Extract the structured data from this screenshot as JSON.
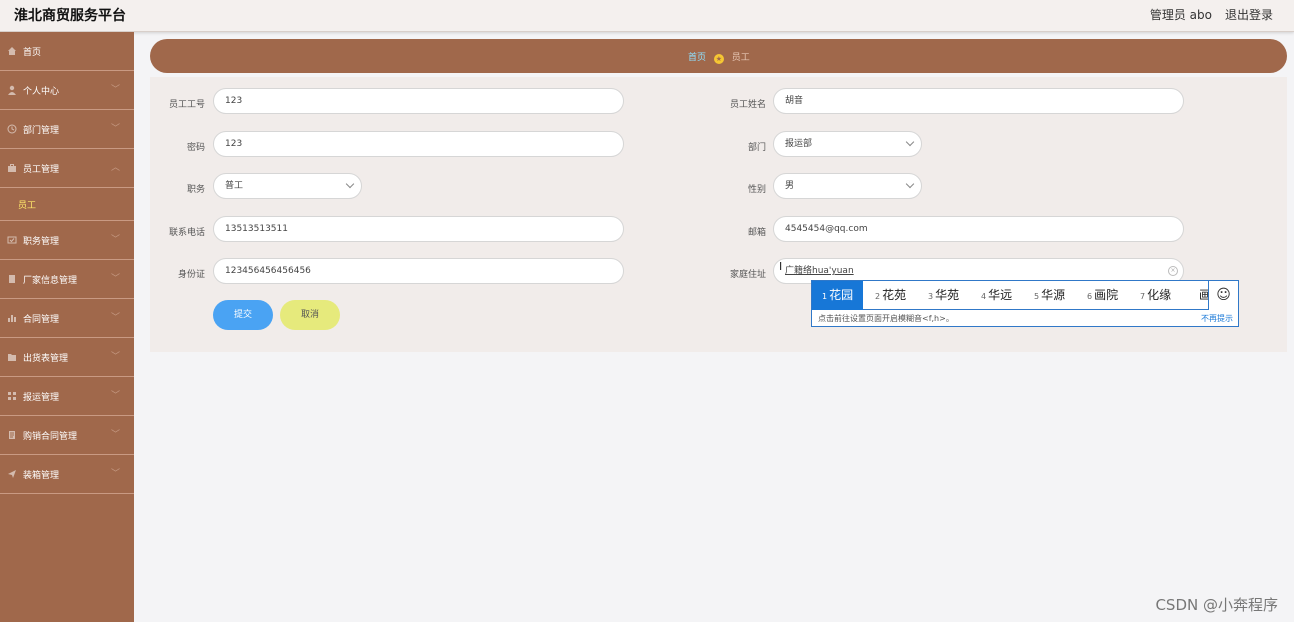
{
  "header": {
    "title": "淮北商贸服务平台",
    "user": "管理员 abo",
    "logout": "退出登录"
  },
  "sidebar": {
    "items": [
      {
        "label": "首页",
        "icon": "home-icon"
      },
      {
        "label": "个人中心",
        "icon": "user-icon"
      },
      {
        "label": "部门管理",
        "icon": "clock-icon"
      },
      {
        "label": "员工管理",
        "icon": "briefcase-icon"
      },
      {
        "label": "员工",
        "icon": ""
      },
      {
        "label": "职务管理",
        "icon": "id-card-icon"
      },
      {
        "label": "厂家信息管理",
        "icon": "file-icon"
      },
      {
        "label": "合同管理",
        "icon": "bar-chart-icon"
      },
      {
        "label": "出货表管理",
        "icon": "folder-icon"
      },
      {
        "label": "报运管理",
        "icon": "grid-icon"
      },
      {
        "label": "购销合同管理",
        "icon": "document-icon"
      },
      {
        "label": "装箱管理",
        "icon": "send-icon"
      }
    ]
  },
  "breadcrumb": {
    "home": "首页",
    "current": "员工"
  },
  "form": {
    "employee_no": {
      "label": "员工工号",
      "value": "123"
    },
    "employee_name": {
      "label": "员工姓名",
      "value": "胡音"
    },
    "password": {
      "label": "密码",
      "value": "123"
    },
    "department": {
      "label": "部门",
      "value": "报运部"
    },
    "position": {
      "label": "职务",
      "value": "普工"
    },
    "gender": {
      "label": "性别",
      "value": "男"
    },
    "phone": {
      "label": "联系电话",
      "value": "13513513511"
    },
    "email": {
      "label": "邮箱",
      "value": "4545454@qq.com"
    },
    "id_card": {
      "label": "身份证",
      "value": "123456456456456"
    },
    "address": {
      "label": "家庭住址",
      "value": "广籍络hua'yuan"
    },
    "submit": "提交",
    "cancel": "取消"
  },
  "ime": {
    "candidates": [
      {
        "n": "1",
        "text": "花园"
      },
      {
        "n": "2",
        "text": "花苑"
      },
      {
        "n": "3",
        "text": "华苑"
      },
      {
        "n": "4",
        "text": "华远"
      },
      {
        "n": "5",
        "text": "华源"
      },
      {
        "n": "6",
        "text": "画院"
      },
      {
        "n": "7",
        "text": "化缘"
      },
      {
        "n": "",
        "text": "画"
      }
    ],
    "emoji": "☺",
    "tip": "点击前往设置页面开启模糊音<f,h>。",
    "dismiss": "不再提示"
  },
  "watermark": "CSDN @小奔程序"
}
